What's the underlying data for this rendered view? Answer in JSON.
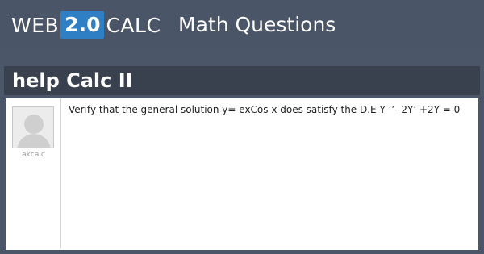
{
  "site": {
    "logo_prefix": "WEB",
    "logo_version": "2.0",
    "logo_suffix": "CALC",
    "section_title": "Math Questions"
  },
  "question": {
    "title": "help Calc II",
    "author": "akcalc",
    "body": "Verify that the general solution y= exCos x does satisfy the D.E Y ’’ -2Y’ +2Y = 0"
  },
  "colors": {
    "header_bg": "#4a5567",
    "title_band": "#39414f",
    "logo_accent": "#2f7fc4"
  },
  "icons": {
    "avatar": "default-user-avatar"
  }
}
